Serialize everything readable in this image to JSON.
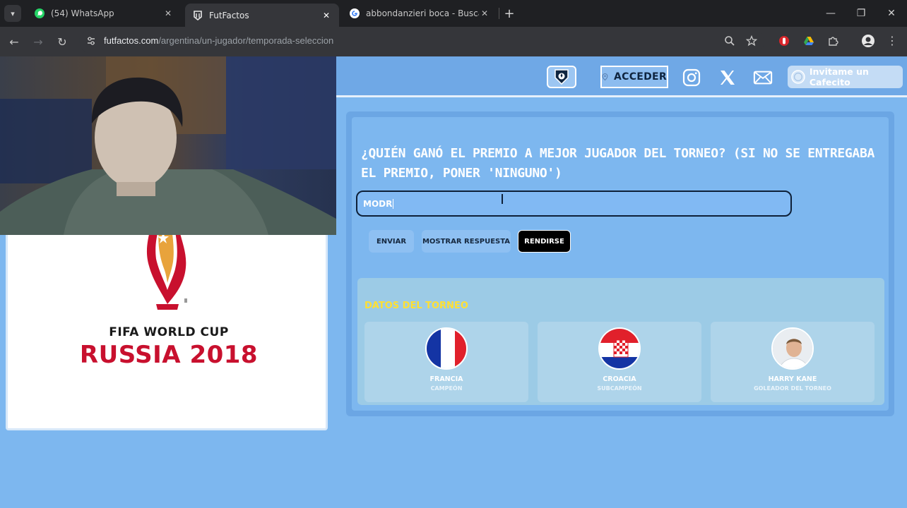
{
  "browser": {
    "tabs": [
      {
        "title": "(54) WhatsApp",
        "icon": "whatsapp-icon",
        "active": false
      },
      {
        "title": "FutFactos",
        "icon": "futfactos-icon",
        "active": true
      },
      {
        "title": "abbondanzieri boca - Buscar co",
        "icon": "google-icon",
        "active": false
      }
    ],
    "url_host": "futfactos.com",
    "url_path": "/argentina/un-jugador/temporada-seleccion"
  },
  "header": {
    "login_label": "ACCEDER",
    "cafecito_label": "Invitame un Cafecito",
    "social_icons": [
      "instagram-icon",
      "x-icon",
      "mail-icon"
    ]
  },
  "left_card": {
    "title": "FIFA WORLD CUP",
    "subtitle": "RUSSIA 2018"
  },
  "quiz": {
    "question": "¿QUIÉN GANÓ EL PREMIO A MEJOR JUGADOR DEL TORNEO? (SI NO SE ENTREGABA EL PREMIO, PONER 'NINGUNO')",
    "answer_value": "MODR",
    "buttons": {
      "submit": "ENVIAR",
      "show_answer": "MOSTRAR RESPUESTA",
      "give_up": "RENDIRSE"
    }
  },
  "tournament": {
    "title": "DATOS DEL TORNEO",
    "cards": [
      {
        "name": "FRANCIA",
        "role": "CAMPEÓN"
      },
      {
        "name": "CROACIA",
        "role": "SUBCAMPEÓN"
      },
      {
        "name": "HARRY KANE",
        "role": "GOLEADOR DEL TORNEO"
      }
    ]
  },
  "colors": {
    "page_bg": "#7db7ef",
    "accent_yellow": "#ffe033",
    "brand_red": "#c8102e"
  }
}
